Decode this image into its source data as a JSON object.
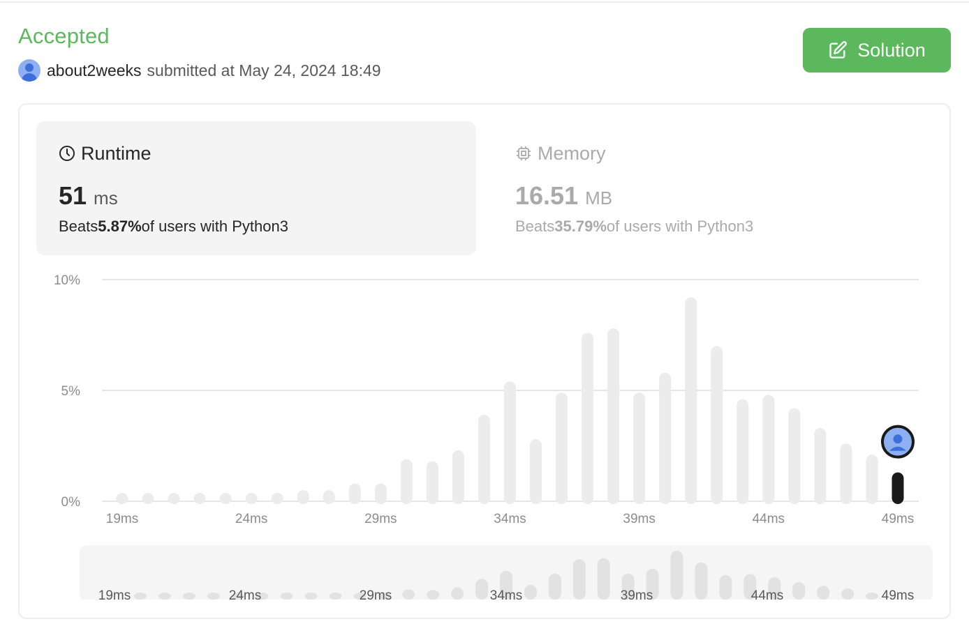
{
  "status": "Accepted",
  "submission": {
    "username": "about2weeks",
    "submitted_text": "submitted at May 24, 2024 18:49"
  },
  "solution_button": {
    "label": "Solution",
    "icon": "edit-icon"
  },
  "runtime": {
    "title": "Runtime",
    "icon": "clock-icon",
    "value": "51",
    "unit": "ms",
    "beats_prefix": "Beats",
    "beats_value": "5.87%",
    "beats_suffix": "of users with Python3"
  },
  "memory": {
    "title": "Memory",
    "icon": "chip-icon",
    "value": "16.51",
    "unit": "MB",
    "beats_prefix": "Beats",
    "beats_value": "35.79%",
    "beats_suffix": "of users with Python3"
  },
  "colors": {
    "accent_green": "#5cb85c",
    "bar": "#ececec",
    "bar_mini": "#e2e2e2",
    "user_bar": "#1a1a1a",
    "avatar_bg": "#8fb0f0",
    "avatar_fg": "#3b6fd9"
  },
  "chart_data": {
    "type": "bar",
    "x": [
      19,
      20,
      21,
      22,
      23,
      24,
      25,
      26,
      27,
      28,
      29,
      30,
      31,
      32,
      33,
      34,
      35,
      36,
      37,
      38,
      39,
      40,
      41,
      42,
      43,
      44,
      45,
      46,
      47,
      48,
      49
    ],
    "values": [
      0.3,
      0.3,
      0.3,
      0.3,
      0.3,
      0.3,
      0.3,
      0.5,
      0.5,
      0.8,
      0.8,
      1.9,
      1.8,
      2.3,
      3.9,
      5.4,
      2.8,
      4.9,
      7.6,
      7.8,
      4.9,
      5.8,
      9.2,
      7.0,
      4.6,
      4.8,
      4.2,
      3.3,
      2.6,
      2.1,
      1.3
    ],
    "highlight_x": 49,
    "xlabel": "",
    "ylabel": "",
    "ylim": [
      0,
      10
    ],
    "y_ticks": [
      "0%",
      "5%",
      "10%"
    ],
    "x_ticks": [
      "19ms",
      "24ms",
      "29ms",
      "34ms",
      "39ms",
      "44ms",
      "49ms"
    ],
    "grid": true,
    "minimap": true
  }
}
